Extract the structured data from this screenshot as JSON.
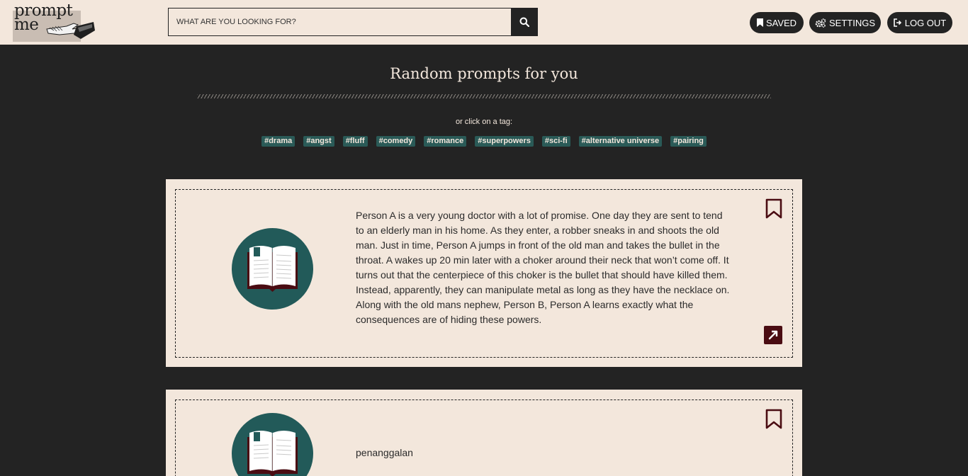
{
  "header": {
    "logo_line1": "prompt",
    "logo_line2": "me",
    "search_placeholder": "WHAT ARE YOU LOOKING FOR?",
    "search_icon": "search-icon",
    "buttons": {
      "saved": "SAVED",
      "settings": "SETTINGS",
      "logout": "LOG OUT"
    }
  },
  "main": {
    "title": "Random prompts for you",
    "tag_hint": "or click on a tag:",
    "tags": [
      "#drama",
      "#angst",
      "#fluff",
      "#comedy",
      "#romance",
      "#superpowers",
      "#sci-fi",
      "#alternative universe",
      "#pairing"
    ]
  },
  "prompts": [
    {
      "text": "Person A is a very young doctor with a lot of promise. One day they are sent to tend to an elderly man in his home. As they enter, a robber sneaks in and shoots the old man. Just in time, Person A jumps in front of the old man and takes the bullet in the throat. A wakes up 20 min later with a choker around their neck that won’t come off. It turns out that the centerpiece of this choker is the bullet that should have killed them. Instead, apparently, they can manipulate metal as long as they have the necklace on. Along with the old mans nephew, Person B, Person A learns exactly what the consequences are of hiding these powers."
    },
    {
      "text": "penanggalan"
    }
  ],
  "colors": {
    "header_bg": "#f3e7dc",
    "page_bg": "#232323",
    "tag_bg": "#2a5a57",
    "accent_dark_red": "#4a0c12"
  }
}
